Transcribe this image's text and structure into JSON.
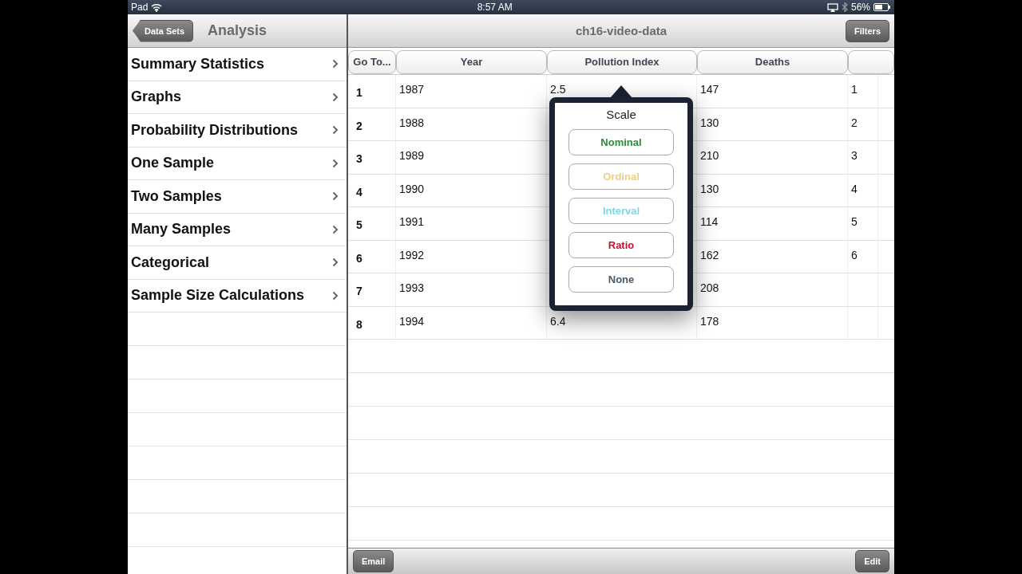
{
  "status_bar": {
    "carrier": "Pad",
    "time": "8:57 AM",
    "battery": "56%"
  },
  "left_nav": {
    "back_button": "Data Sets",
    "title": "Analysis"
  },
  "menu": [
    {
      "label": "Summary Statistics"
    },
    {
      "label": "Graphs"
    },
    {
      "label": "Probability Distributions"
    },
    {
      "label": "One Sample"
    },
    {
      "label": "Two Samples"
    },
    {
      "label": "Many Samples"
    },
    {
      "label": "Categorical"
    },
    {
      "label": "Sample Size Calculations"
    }
  ],
  "right_nav": {
    "title": "ch16-video-data",
    "filters_button": "Filters"
  },
  "table": {
    "columns": [
      "Go To...",
      "Year",
      "Pollution Index",
      "Deaths"
    ],
    "rows": [
      {
        "number": "1",
        "year": "1987",
        "pollution_index": "2.5",
        "deaths": "147",
        "column_5": "1"
      },
      {
        "number": "2",
        "year": "1988",
        "deaths": "130",
        "column_5": "2"
      },
      {
        "number": "3",
        "year": "1989",
        "deaths": "210",
        "column_5": "3"
      },
      {
        "number": "4",
        "year": "1990",
        "deaths": "130",
        "column_5": "4"
      },
      {
        "number": "5",
        "year": "1991",
        "deaths": "114",
        "column_5": "5"
      },
      {
        "number": "6",
        "year": "1992",
        "deaths": "162",
        "column_5": "6"
      },
      {
        "number": "7",
        "year": "1993",
        "deaths": "208"
      },
      {
        "number": "8",
        "year": "1994",
        "pollution_index": "6.4",
        "deaths": "178"
      }
    ]
  },
  "popover": {
    "title": "Scale",
    "options": [
      {
        "label": "Nominal",
        "color": "#2e8b3a"
      },
      {
        "label": "Ordinal",
        "color": "#f0d080"
      },
      {
        "label": "Interval",
        "color": "#7fd6e6"
      },
      {
        "label": "Ratio",
        "color": "#c8102e"
      },
      {
        "label": "None",
        "color": "#4a5a6a"
      }
    ]
  },
  "toolbar": {
    "email_button": "Email",
    "edit_button": "Edit"
  }
}
